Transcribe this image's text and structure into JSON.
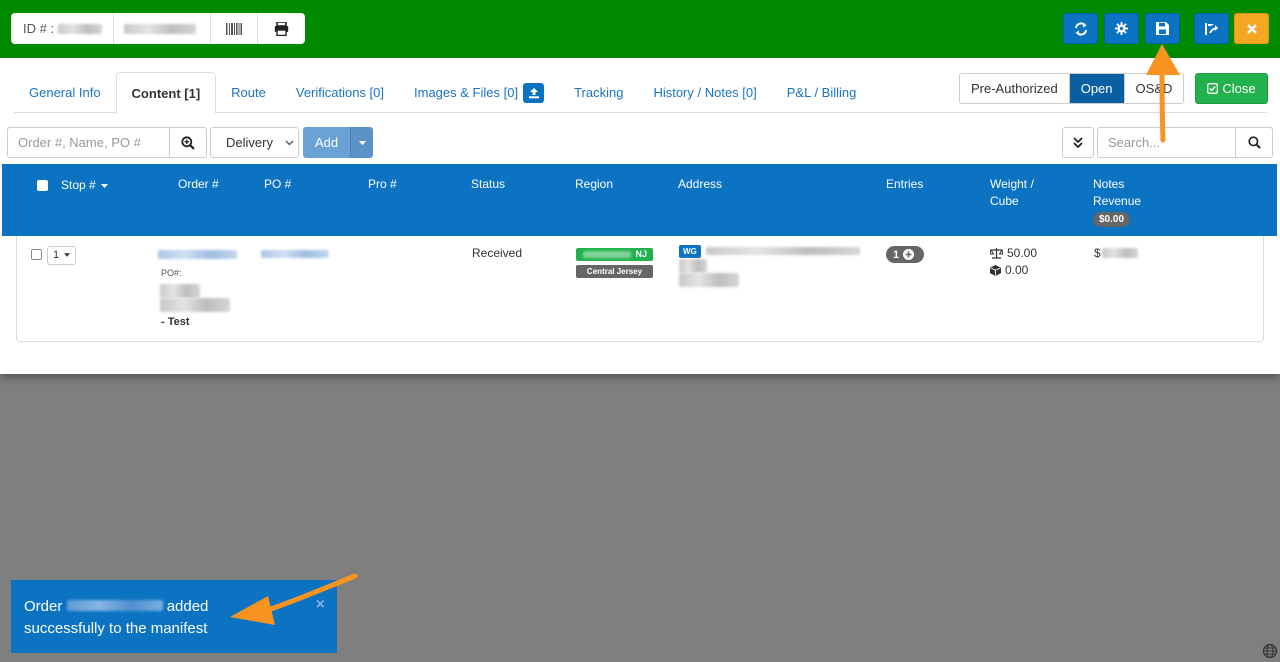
{
  "header": {
    "id_label": "ID # :",
    "barcode_icon": "barcode-icon",
    "print_icon": "print-icon",
    "buttons": [
      "refresh-icon",
      "gear-icon",
      "save-icon",
      "route-icon",
      "close-icon"
    ]
  },
  "tabs": [
    {
      "label": "General Info",
      "active": false
    },
    {
      "label": "Content [1]",
      "active": true
    },
    {
      "label": "Route",
      "active": false
    },
    {
      "label": "Verifications [0]",
      "active": false
    },
    {
      "label": "Images & Files [0]",
      "active": false
    },
    {
      "label": "Tracking",
      "active": false
    },
    {
      "label": "History / Notes [0]",
      "active": false
    },
    {
      "label": "P&L / Billing",
      "active": false
    }
  ],
  "status_toggle": {
    "options": [
      "Pre-Authorized",
      "Open",
      "OS&D"
    ],
    "selected": "Open"
  },
  "close_button": "Close",
  "filters": {
    "order_placeholder": "Order #, Name, PO #",
    "type_select": "Delivery",
    "add_label": "Add",
    "search_placeholder": "Search..."
  },
  "table": {
    "headers": {
      "stop": "Stop #",
      "order": "Order #",
      "po": "PO #",
      "pro": "Pro #",
      "status": "Status",
      "region": "Region",
      "address": "Address",
      "entries": "Entries",
      "weight": "Weight /",
      "cube": "Cube",
      "notes": "Notes",
      "revenue": "Revenue",
      "revenue_badge": "$0.00"
    },
    "rows": [
      {
        "stop": "1",
        "po_label": "PO#:",
        "name_suffix": "- Test",
        "status": "Received",
        "region_state": "NJ",
        "region_name": "Central Jersey",
        "address_tag": "WG",
        "entries": "1",
        "weight": "50.00",
        "cube": "0.00",
        "revenue_prefix": "$"
      }
    ]
  },
  "toast": {
    "prefix": "Order",
    "middle": "added",
    "suffix": "successfully to the manifest",
    "close": "×"
  },
  "colors": {
    "header_green": "#008a00",
    "primary_blue": "#0b73c2",
    "success_green": "#22b14c",
    "warning_orange": "#f5a623",
    "annotation_arrow": "#f7931e"
  }
}
